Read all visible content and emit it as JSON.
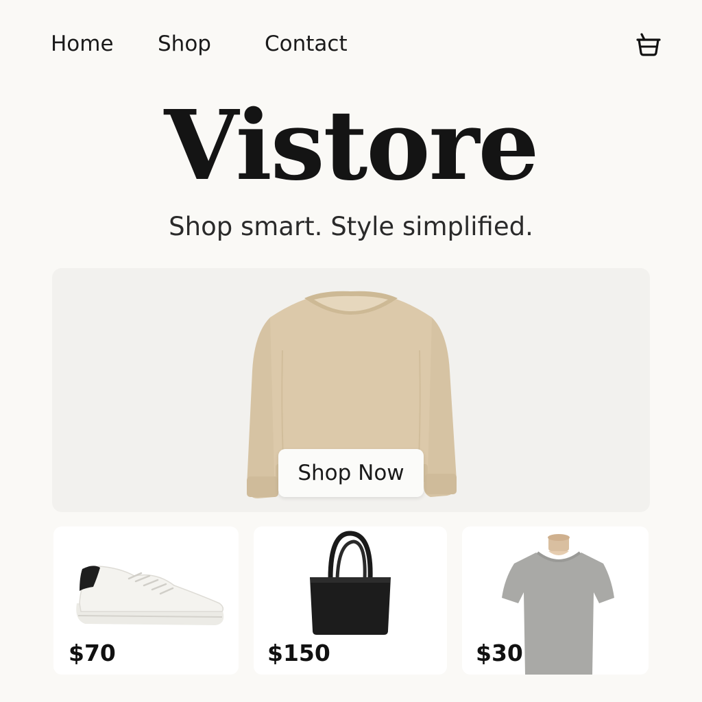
{
  "nav": {
    "items": [
      {
        "label": "Home"
      },
      {
        "label": "Shop"
      },
      {
        "label": "Contact"
      }
    ],
    "cart_icon": "shopping-basket-icon"
  },
  "hero": {
    "brand": "Vistore",
    "tagline": "Shop smart. Style simplified.",
    "cta_label": "Shop Now",
    "image": "beige-sweater"
  },
  "products": [
    {
      "price": "$70",
      "image": "white-sneaker"
    },
    {
      "price": "$150",
      "image": "black-tote-bag"
    },
    {
      "price": "$30",
      "image": "gray-t-shirt"
    }
  ],
  "colors": {
    "background": "#faf9f6",
    "hero_panel": "#f2f1ee",
    "text": "#1a1a1a",
    "sweater": "#d9c6a6"
  }
}
